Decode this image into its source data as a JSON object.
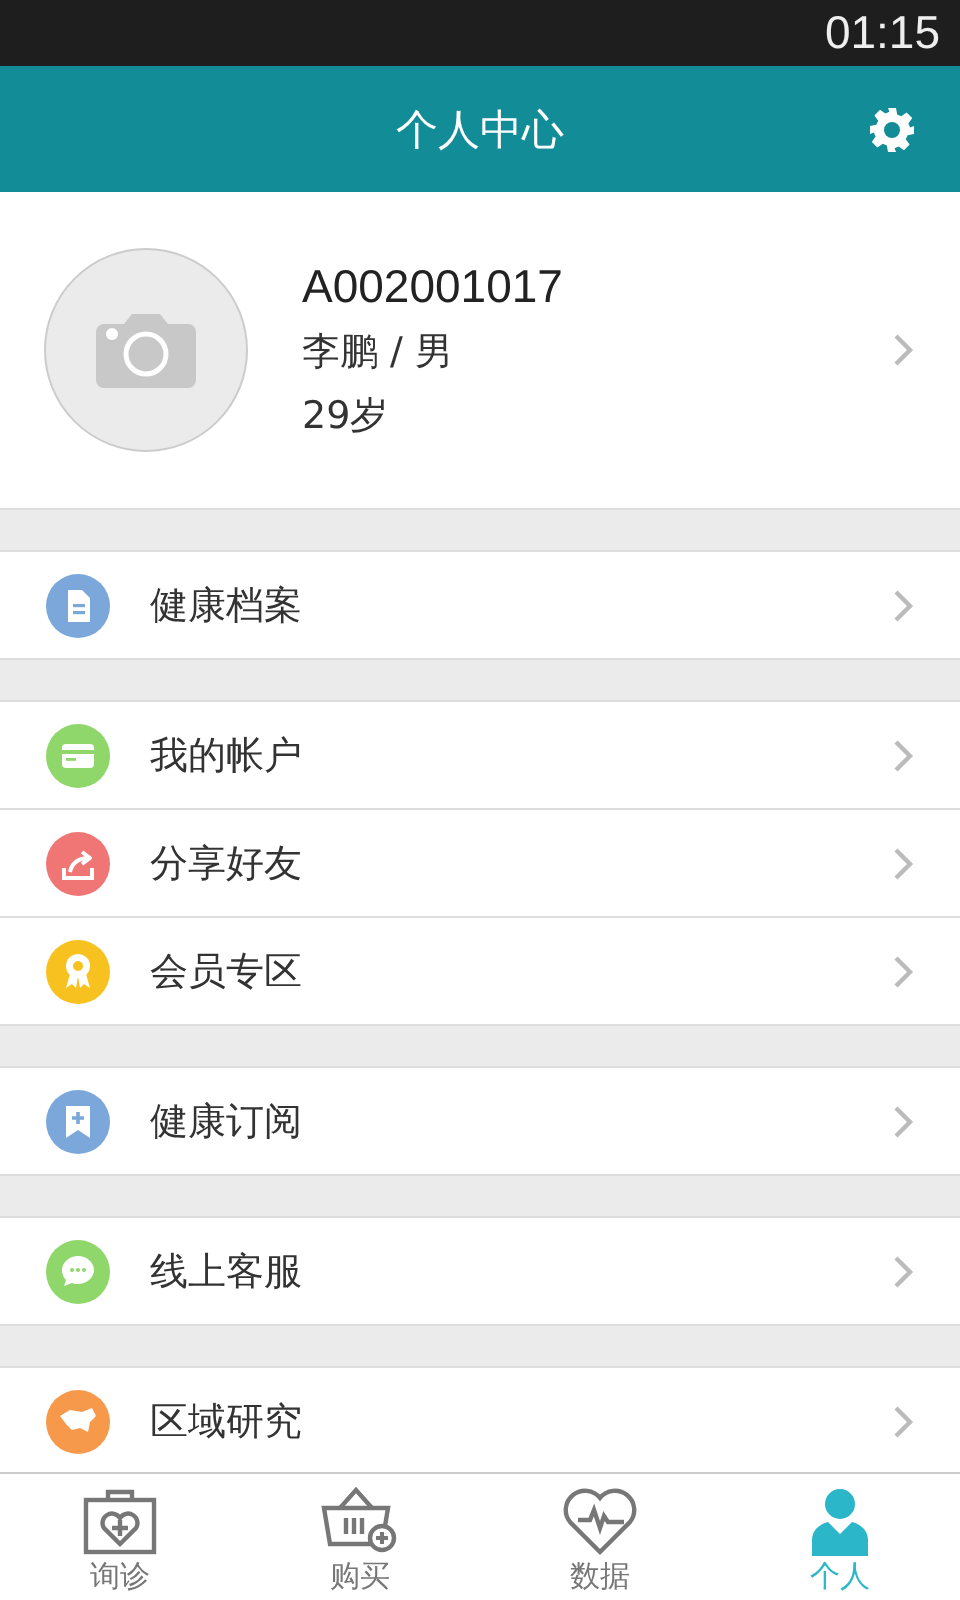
{
  "status_bar": {
    "time": "01:15"
  },
  "header": {
    "title": "个人中心"
  },
  "profile": {
    "id": "A002001017",
    "name_gender": "李鹏 / 男",
    "age": "29岁"
  },
  "menu_groups": [
    {
      "items": [
        {
          "label": "健康档案",
          "kind": "document",
          "color": "#7ba7db"
        }
      ]
    },
    {
      "items": [
        {
          "label": "我的帐户",
          "kind": "card",
          "color": "#8fd66b"
        },
        {
          "label": "分享好友",
          "kind": "share",
          "color": "#f07676"
        },
        {
          "label": "会员专区",
          "kind": "award",
          "color": "#f7c21f"
        }
      ]
    },
    {
      "items": [
        {
          "label": "健康订阅",
          "kind": "bookmark",
          "color": "#7ba7db"
        }
      ]
    },
    {
      "items": [
        {
          "label": "线上客服",
          "kind": "chat",
          "color": "#8fd66b"
        }
      ]
    },
    {
      "items": [
        {
          "label": "区域研究",
          "kind": "map",
          "color": "#f7994a"
        }
      ]
    }
  ],
  "tabs": [
    {
      "label": "询诊",
      "kind": "kit",
      "selected": false
    },
    {
      "label": "购买",
      "kind": "basket",
      "selected": false
    },
    {
      "label": "数据",
      "kind": "heart",
      "selected": false
    },
    {
      "label": "个人",
      "kind": "person",
      "selected": true
    }
  ]
}
